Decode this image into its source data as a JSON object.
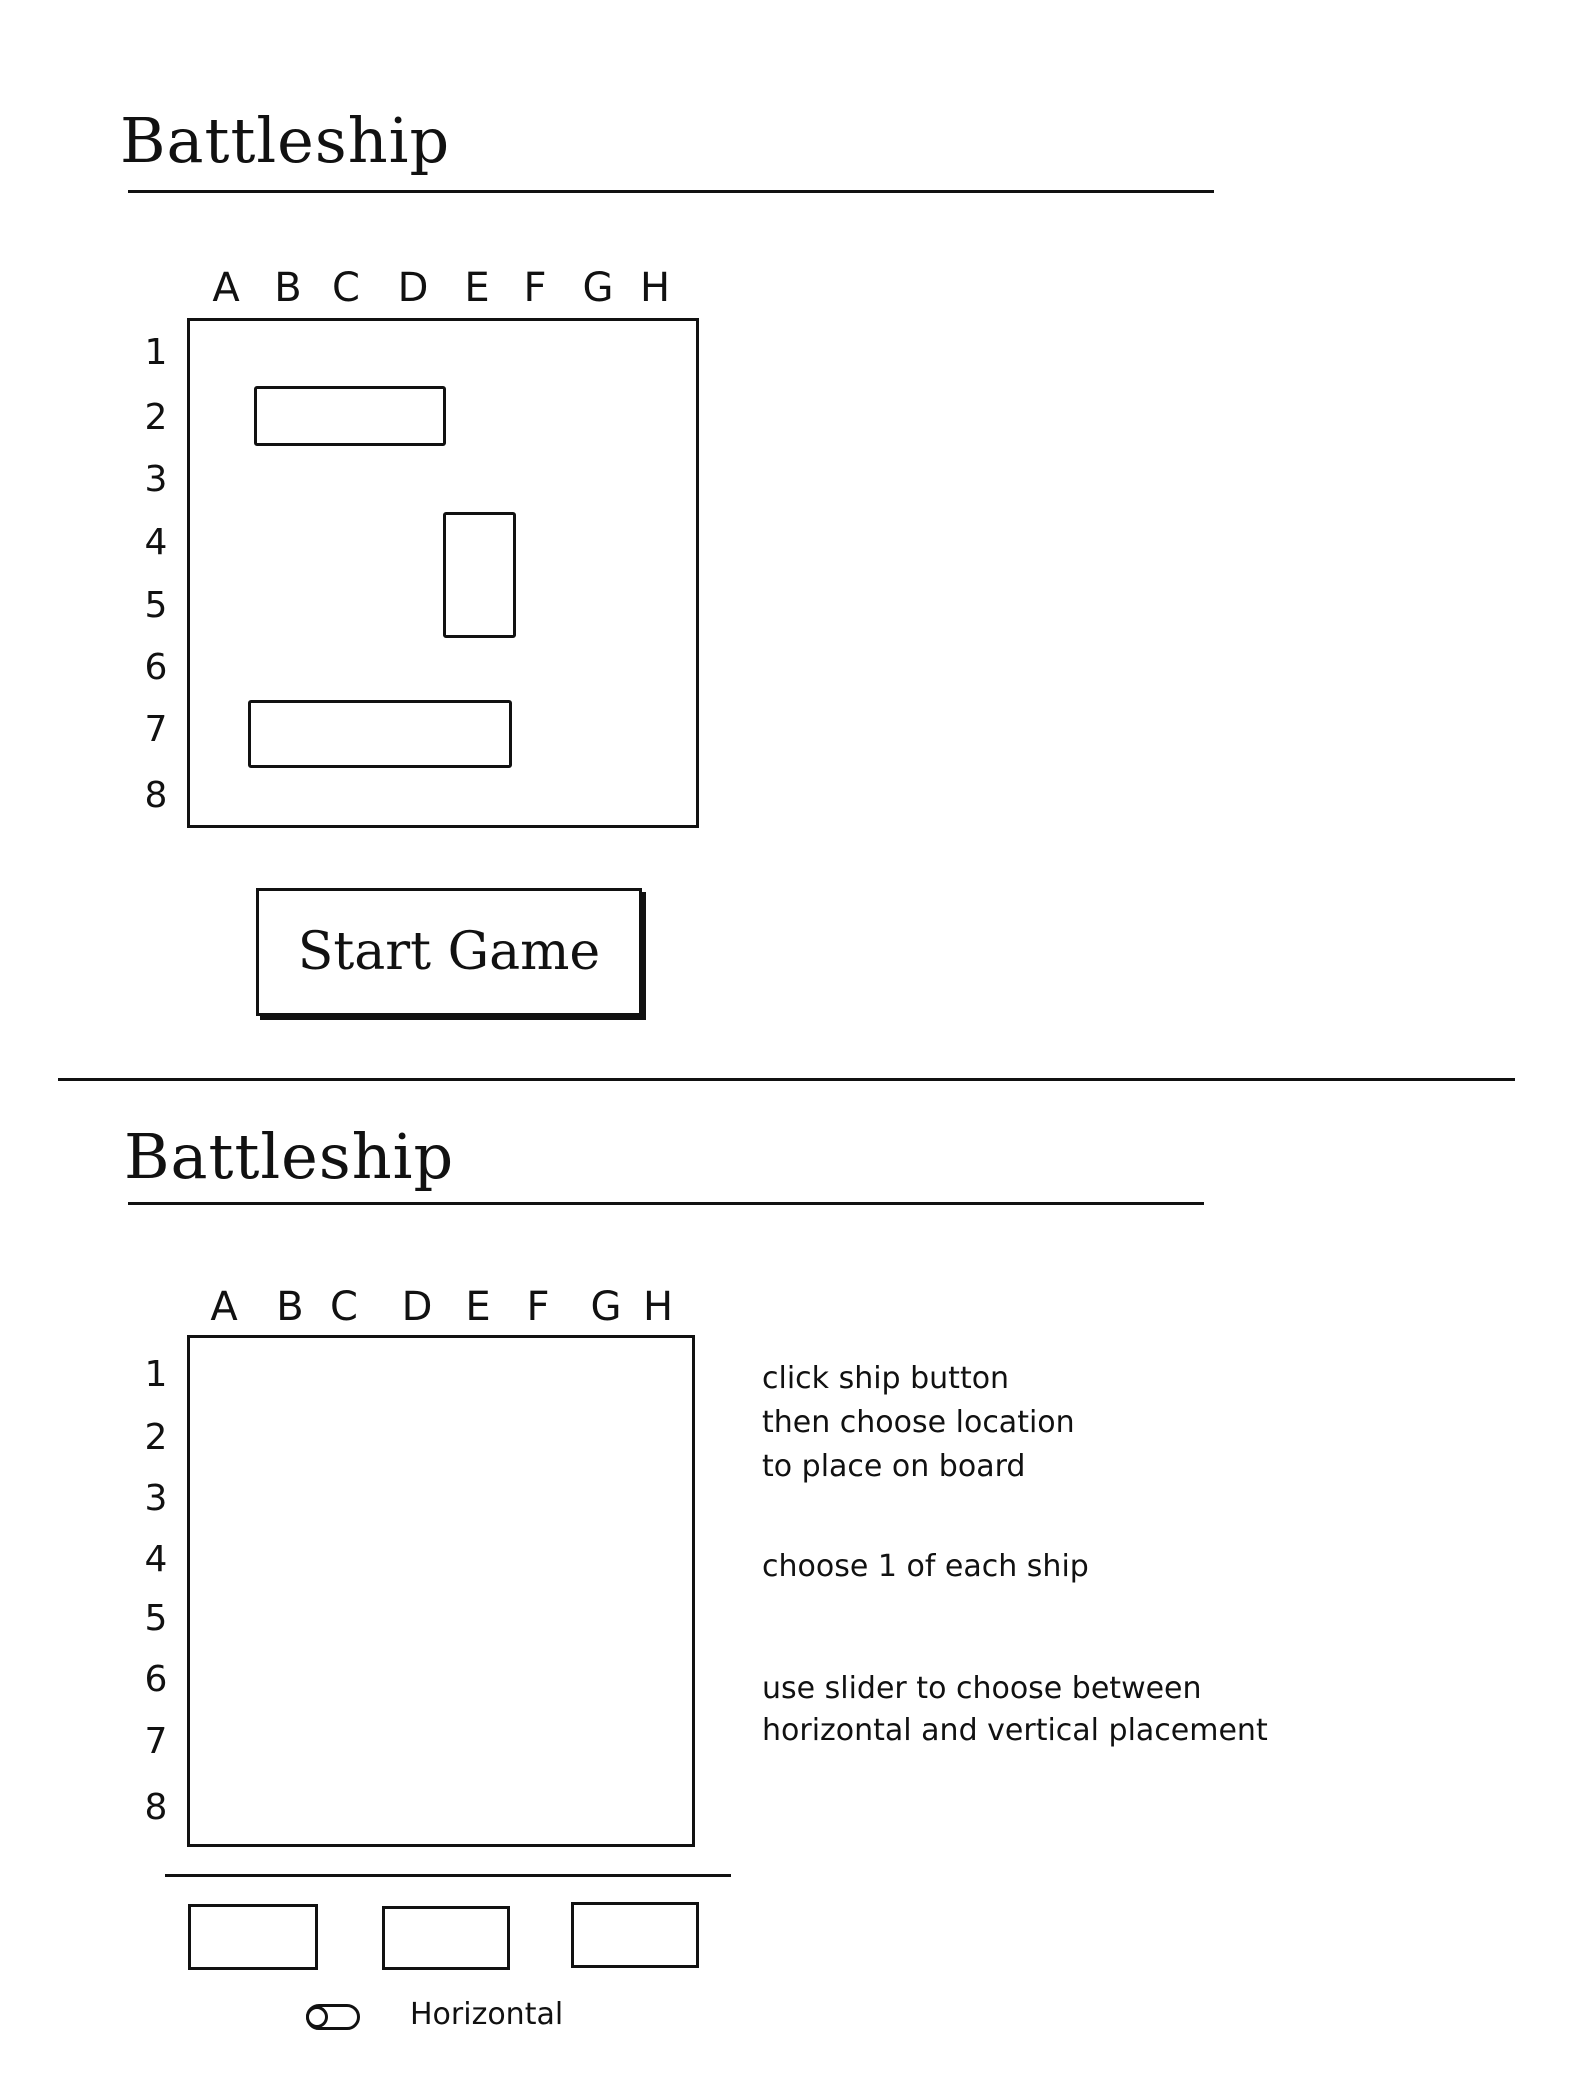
{
  "screen1": {
    "title": "Battleship",
    "columns": [
      "A",
      "B",
      "C",
      "D",
      "E",
      "F",
      "G",
      "H"
    ],
    "rows": [
      "1",
      "2",
      "3",
      "4",
      "5",
      "6",
      "7",
      "8"
    ],
    "start_button": "Start Game"
  },
  "screen2": {
    "title": "Battleship",
    "columns": [
      "A",
      "B",
      "C",
      "D",
      "E",
      "F",
      "G",
      "H"
    ],
    "rows": [
      "1",
      "2",
      "3",
      "4",
      "5",
      "6",
      "7",
      "8"
    ],
    "orientation_toggle": {
      "label": "Horizontal"
    },
    "instructions": {
      "line1": "click ship button",
      "line2": "then choose location",
      "line3": "to place on board",
      "line4": "choose 1 of each ship",
      "line5": "use slider to choose between",
      "line6": "horizontal and vertical placement"
    }
  }
}
